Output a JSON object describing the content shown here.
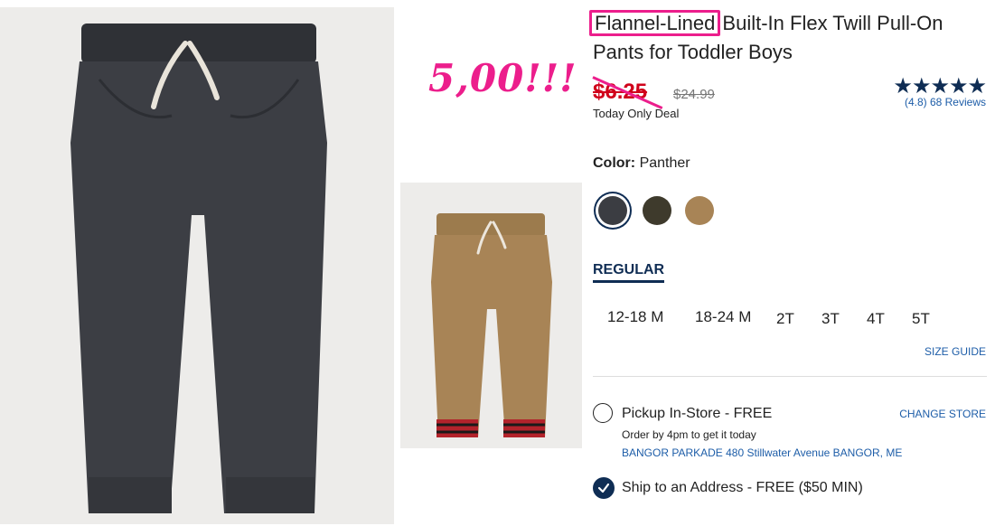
{
  "product": {
    "title_highlight": "Flannel-Lined",
    "title_rest": " Built-In Flex Twill Pull-On Pants for Toddler Boys",
    "annotation": "5,00!!!",
    "sale_price": "$6.25",
    "original_price": "$24.99",
    "deal_text": "Today Only Deal",
    "rating_stars": "★★★★★",
    "reviews": "(4.8) 68 Reviews"
  },
  "color": {
    "label": "Color:",
    "value": "Panther",
    "swatches": [
      {
        "name": "Panther",
        "hex": "#3b3d42",
        "selected": true
      },
      {
        "name": "Olive",
        "hex": "#3e3a2c",
        "selected": false
      },
      {
        "name": "Tan",
        "hex": "#a88456",
        "selected": false
      }
    ]
  },
  "fit": {
    "tab": "REGULAR"
  },
  "sizes": [
    "12-18 M",
    "18-24 M",
    "2T",
    "3T",
    "4T",
    "5T"
  ],
  "size_guide": "SIZE GUIDE",
  "fulfillment": {
    "pickup_label": "Pickup In-Store - FREE",
    "change_store": "CHANGE STORE",
    "order_by": "Order by 4pm to get it today",
    "store_address": "BANGOR PARKADE 480 Stillwater Avenue  BANGOR, ME",
    "ship_label": "Ship to an Address - FREE ($50 MIN)"
  },
  "colors": {
    "accent": "#0f2d54",
    "sale": "#d0021b",
    "highlight": "#ec1e8c",
    "link": "#1d5da8"
  }
}
